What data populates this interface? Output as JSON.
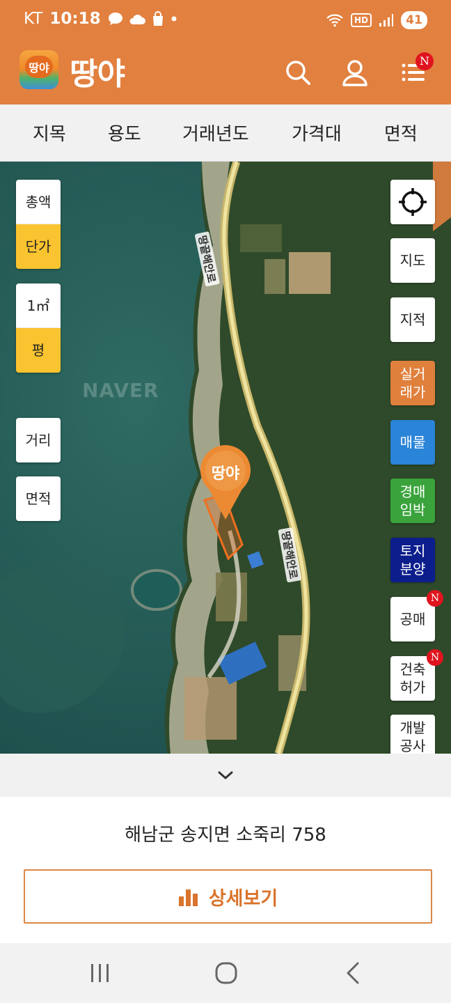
{
  "status_bar": {
    "carrier": "KT",
    "time": "10:18",
    "hd": "HD",
    "battery": "41"
  },
  "header": {
    "logo_badge": "땅야",
    "logo_text": "땅야",
    "menu_badge": "N"
  },
  "filters": [
    "지목",
    "용도",
    "거래년도",
    "가격대",
    "면적"
  ],
  "map": {
    "watermark": "NAVER",
    "road_name": "땅끝해안로",
    "marker_label": "땅야",
    "left_controls": {
      "total": "총액",
      "unit_price": "단가",
      "sqm": "1㎡",
      "pyeong": "평",
      "distance": "거리",
      "area": "면적"
    },
    "right_controls": {
      "map": "지도",
      "cadastral": "지적",
      "real_trade_1": "실거",
      "real_trade_2": "래가",
      "listings": "매물",
      "auction_1": "경매",
      "auction_2": "임박",
      "land_1": "토지",
      "land_2": "분양",
      "public_sale": "공매",
      "permit_1": "건축",
      "permit_2": "허가",
      "dev_1": "개발",
      "dev_2": "공사",
      "badge": "N"
    }
  },
  "info_panel": {
    "address": "해남군 송지면 소죽리 758",
    "detail_button": "상세보기"
  },
  "colors": {
    "brand_orange": "#e2803f",
    "unit_yellow": "#f9c42f",
    "listing_blue": "#2a84d8",
    "auction_green": "#3aa33b",
    "land_navy": "#0c1e8c",
    "badge_red": "#e0141e"
  }
}
